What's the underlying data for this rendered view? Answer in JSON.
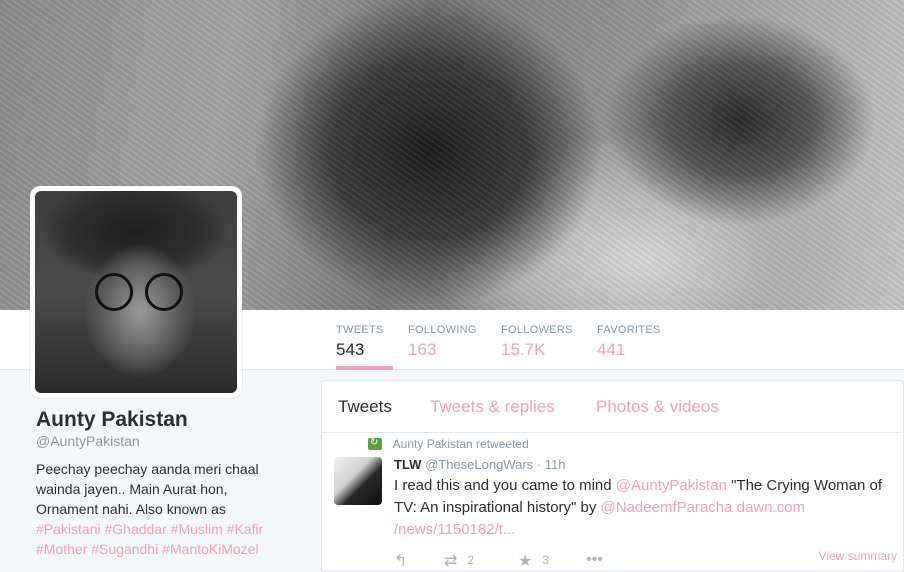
{
  "profile": {
    "name": "Aunty Pakistan",
    "handle": "@AuntyPakistan",
    "bio_lines": [
      "Peechay peechay aanda meri chaal",
      "wainda jayen.. Main Aurat hon,",
      "Ornament nahi. Also known as"
    ],
    "hashtags": [
      "#Pakistani",
      "#Ghaddar",
      "#Muslim",
      "#Kafir",
      "#Mother",
      "#Sugandhi",
      "#MantoKiMozel"
    ]
  },
  "stats": [
    {
      "label": "TWEETS",
      "value": "543"
    },
    {
      "label": "FOLLOWING",
      "value": "163"
    },
    {
      "label": "FOLLOWERS",
      "value": "15.7K"
    },
    {
      "label": "FAVORITES",
      "value": "441"
    }
  ],
  "tabs": [
    "Tweets",
    "Tweets & replies",
    "Photos & videos"
  ],
  "tweet": {
    "retweeted_by": "Aunty Pakistan retweeted",
    "author": "TLW",
    "author_handle": "@TheseLongWars",
    "time": "· 11h",
    "text_plain_1": "I read this and you came to mind ",
    "mention_1": "@AuntyPakistan",
    "text_plain_2": " \"The Crying Woman of TV: An inspirational history\" by ",
    "mention_2": "@NadeemfParacha",
    "link_1": "dawn.com",
    "link_2": "/news/1150182/t...",
    "retweet_count": "2",
    "favorite_count": "3",
    "view_summary": "View summary"
  },
  "colors": {
    "accent": "#f2a1b5",
    "text": "#292f33",
    "muted": "#8899a6",
    "retweet_green": "#5c9e3c"
  },
  "icons": [
    "reply-icon",
    "retweet-icon",
    "favorite-icon",
    "more-icon"
  ]
}
